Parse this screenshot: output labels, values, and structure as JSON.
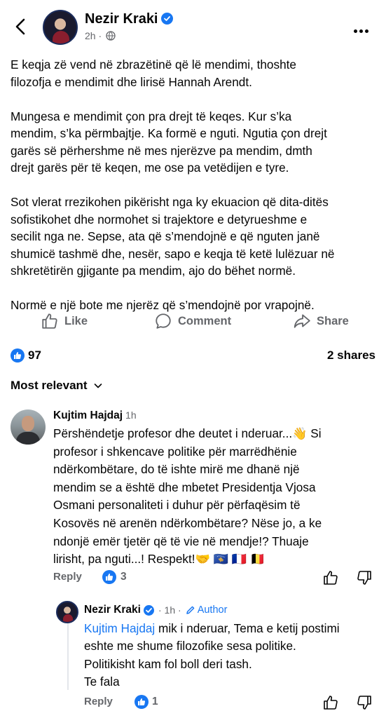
{
  "header": {
    "author": "Nezir Kraki",
    "time": "2h",
    "privacy_icon": "globe-icon"
  },
  "post": {
    "paragraphs": [
      "E keqja zë vend në zbrazëtinë që lë mendimi, thoshte\nfilozofja e mendimit dhe lirisë Hannah Arendt.",
      "Mungesa e mendimit çon pra drejt të keqes. Kur s’ka\nmendim, s’ka përmbajtje. Ka formë e nguti. Ngutia çon drejt\ngarës së përhershme në mes njerëzve pa mendim, dmth\ndrejt garës për të keqen, me ose pa vetëdijen e tyre.",
      "Sot vlerat rrezikohen pikërisht nga ky ekuacion që dita-ditës\nsofistikohet dhe normohet si trajektore e detyrueshme e\nsecilit nga ne. Sepse, ata që s’mendojnë e që nguten janë\nshumicë tashmë dhe, nesër, sapo e keqja të ketë lulëzuar në\nshkretëtirën gjigante pa mendim, ajo do bëhet normë.",
      "Normë e një bote me njerëz që s’mendojnë por vrapojnë."
    ]
  },
  "actions": {
    "like": "Like",
    "comment": "Comment",
    "share": "Share"
  },
  "stats": {
    "reactions": "97",
    "shares": "2 shares"
  },
  "sort": {
    "label": "Most relevant"
  },
  "comment": {
    "author": "Kujtim Hajdaj",
    "time": "1h",
    "text": "Përshëndetje profesor dhe deutet i nderuar...👋 Si\nprofesor i shkencave politike për marrëdhënie\nndërkombëtare, do të ishte mirë me dhanë një\nmendim se a është dhe mbetet Presidentja Vjosa\nOsmani personaliteti i duhur për përfaqësim të\nKosovës në arenën ndërkombëtare? Nëse jo, a ke\nndonjë emër tjetër që të vie në mendje!? Thuaje\nlirisht, pa nguti...! Respekt!🤝 🇽🇰 🇫🇷 🇧🇪",
    "reply_label": "Reply",
    "like_count": "3"
  },
  "reply": {
    "author": "Nezir Kraki",
    "time": "1h",
    "badge": "Author",
    "mention": "Kujtim Hajdaj",
    "line1_rest": " mik i nderuar, Tema e ketij postimi",
    "rest": "eshte me shume filozofike sesa politike.\nPolitikisht kam fol boll deri tash.\nTe fala",
    "reply_label": "Reply",
    "like_count": "1"
  },
  "colors": {
    "accent": "#1877f2",
    "secondary_text": "#65676b",
    "primary_text": "#050505"
  }
}
